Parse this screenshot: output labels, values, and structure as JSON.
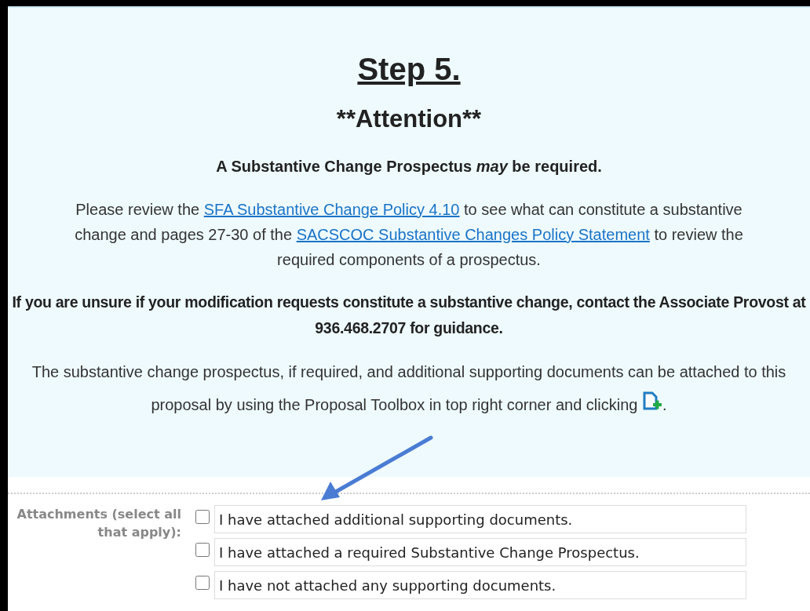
{
  "step_title": "Step 5.",
  "attention": "**Attention**",
  "notice": "A Substantive Change Prospectus *may* be required.",
  "review": {
    "before": "Please review the",
    "link1": "SFA Substantive Change Policy 4.10",
    "middle": "to see what can constitute a substantive change and pages 27-30 of the",
    "link2": "SACSCOC Substantive Changes Policy Statement",
    "after": "to review the required components of a prospectus."
  },
  "contact": "If you are unsure if your modification requests constitute a substantive change, contact the Associate Provost at 936.468.2707 for guidance.",
  "attach_note": {
    "text": "The substantive change prospectus, if required, and additional supporting documents can be attached to this proposal by using the Proposal Toolbox in top right corner and clicking",
    "end": "."
  },
  "attachments": {
    "label": "Attachments (select all that apply):",
    "options": [
      {
        "label": "I have attached additional supporting documents.",
        "checked": false
      },
      {
        "label": "I have attached a required Substantive Change Prospectus.",
        "checked": false
      },
      {
        "label": "I have not attached any supporting documents.",
        "checked": false
      }
    ]
  }
}
